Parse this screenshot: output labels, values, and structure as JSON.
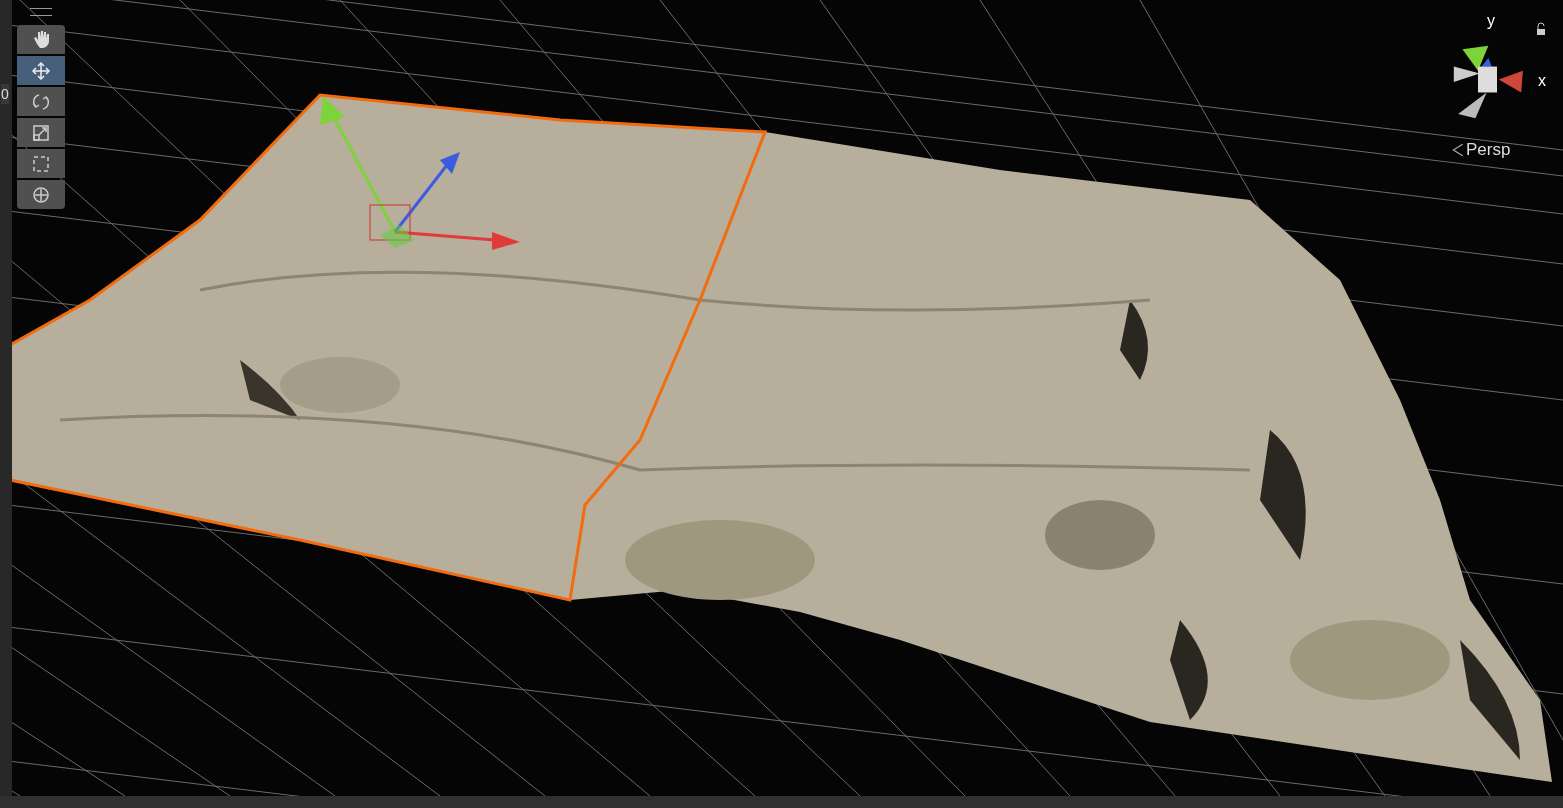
{
  "side_panel": {
    "text": "0"
  },
  "tools": [
    {
      "kind": "hand",
      "selected": false
    },
    {
      "kind": "move",
      "selected": true
    },
    {
      "kind": "rotate",
      "selected": false
    },
    {
      "kind": "scale",
      "selected": false
    },
    {
      "kind": "rect",
      "selected": false
    },
    {
      "kind": "transform",
      "selected": false
    }
  ],
  "orientation_gizmo": {
    "y_label": "y",
    "x_label": "x",
    "locked": false,
    "projection": "Persp"
  }
}
